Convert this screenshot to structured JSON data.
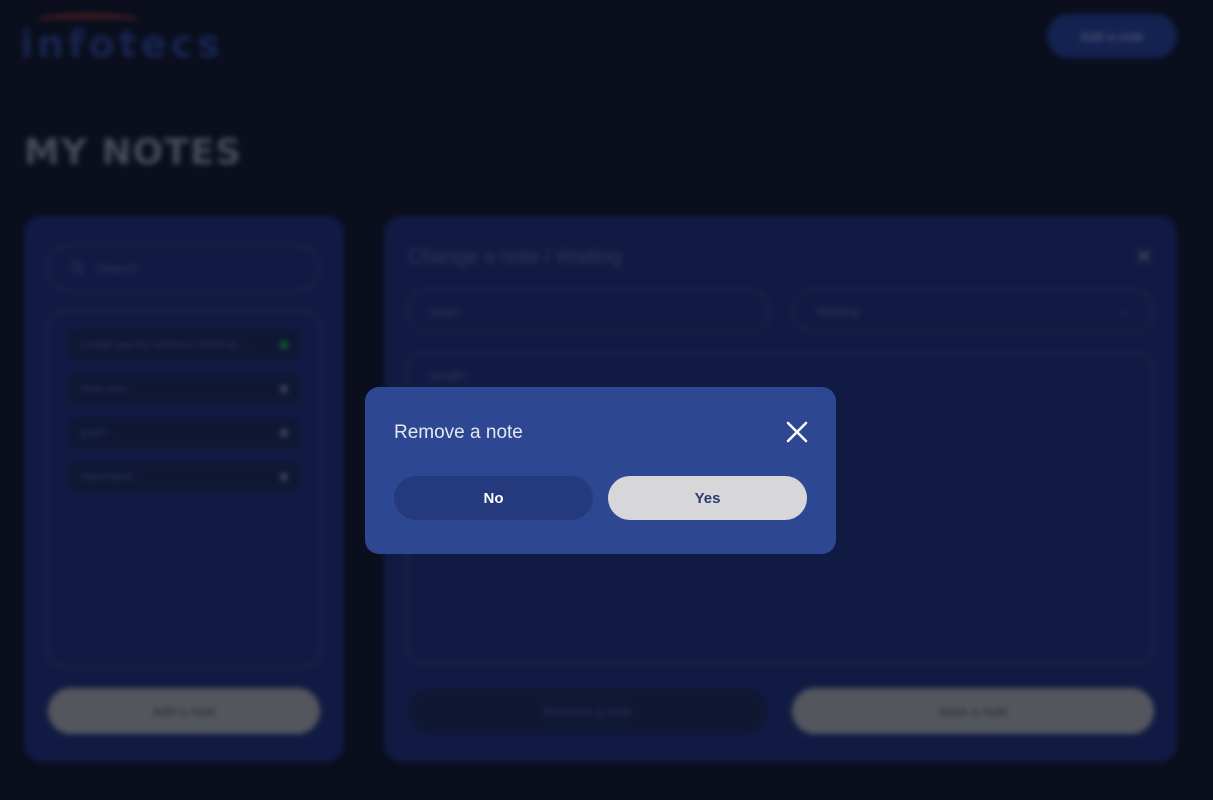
{
  "header": {
    "logo_text": "infotecs",
    "add_button_label": "Add a note"
  },
  "page": {
    "title": "MY NOTES"
  },
  "sidebar": {
    "search_placeholder": "Search",
    "items": [
      {
        "label": "Create app for infotecs CSS3 ve...",
        "status": "active"
      },
      {
        "label": "New note",
        "status": "inactive"
      },
      {
        "label": "gmjm",
        "status": "inactive"
      },
      {
        "label": "Hahahaha!",
        "status": "inactive"
      }
    ],
    "add_button_label": "Add a note"
  },
  "editor": {
    "title": "Change a note / Waiting",
    "title_field_value": "gmjm",
    "status_value": "Waiting",
    "body_value": "gmgfh",
    "remove_button_label": "Remove a note",
    "save_button_label": "Save a note"
  },
  "modal": {
    "title": "Remove a note",
    "no_label": "No",
    "yes_label": "Yes"
  },
  "colors": {
    "background": "#0b0f1e",
    "panel": "#1b2a6e",
    "modal": "#2e4793",
    "no_button": "#243a7c",
    "yes_button": "#d7d7d9",
    "active_dot": "#2fbf4f"
  }
}
